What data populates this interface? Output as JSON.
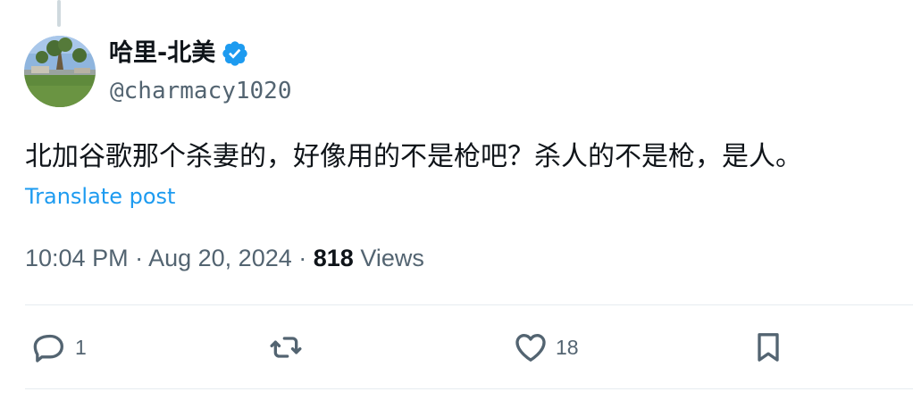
{
  "author": {
    "display_name": "哈里-北美",
    "handle": "@charmacy1020",
    "verified_icon": "verified-badge-icon",
    "badge_color": "#1d9bf0"
  },
  "post": {
    "text": "北加谷歌那个杀妻的，好像用的不是枪吧？杀人的不是枪，是人。",
    "translate_label": "Translate post"
  },
  "meta": {
    "time": "10:04 PM",
    "separator1": " · ",
    "date": "Aug 20, 2024",
    "separator2": " · ",
    "views_count": "818",
    "views_label": " Views"
  },
  "actions": {
    "reply": {
      "icon": "reply-icon",
      "count": "1"
    },
    "repost": {
      "icon": "repost-icon",
      "count": ""
    },
    "like": {
      "icon": "heart-icon",
      "count": "18"
    },
    "bookmark": {
      "icon": "bookmark-icon",
      "count": ""
    }
  },
  "colors": {
    "text": "#0f1419",
    "secondary": "#536471",
    "link": "#1d9bf0",
    "divider": "#e6ecf0"
  }
}
